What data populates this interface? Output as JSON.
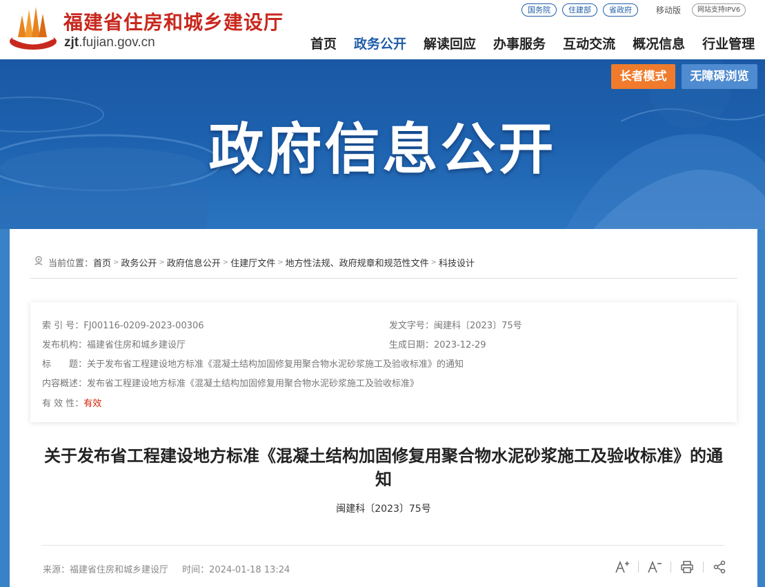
{
  "site": {
    "name": "福建省住房和城乡建设厅",
    "domain_prefix": "zjt",
    "domain_suffix": ".fujian.gov.cn"
  },
  "top_links": [
    "国务院",
    "住建部",
    "省政府"
  ],
  "mobile_label": "移动版",
  "ipv6_label": "网站支持IPV6",
  "nav": [
    "首页",
    "政务公开",
    "解读回应",
    "办事服务",
    "互动交流",
    "概况信息",
    "行业管理"
  ],
  "nav_active": "政务公开",
  "banner": {
    "title": "政府信息公开",
    "elder_mode": "长者模式",
    "accessible": "无障碍浏览"
  },
  "breadcrumb": {
    "label": "当前位置：",
    "items": [
      "首页",
      "政务公开",
      "政府信息公开",
      "住建厅文件",
      "地方性法规、政府规章和规范性文件",
      "科技设计"
    ]
  },
  "meta": {
    "index_label": "索 引 号：",
    "index_value": "FJ00116-0209-2023-00306",
    "doc_no_label": "发文字号：",
    "doc_no_value": "闽建科〔2023〕75号",
    "issuer_label": "发布机构：",
    "issuer_value": "福建省住房和城乡建设厅",
    "date_label": "生成日期：",
    "date_value": "2023-12-29",
    "title_label": "标　　题：",
    "title_value": "关于发布省工程建设地方标准《混凝土结构加固修复用聚合物水泥砂浆施工及验收标准》的通知",
    "summary_label": "内容概述：",
    "summary_value": "发布省工程建设地方标准《混凝土结构加固修复用聚合物水泥砂浆施工及验收标准》",
    "validity_label": "有 效 性：",
    "validity_value": "有效"
  },
  "document": {
    "title": "关于发布省工程建设地方标准《混凝土结构加固修复用聚合物水泥砂浆施工及验收标准》的通知",
    "number": "闽建科〔2023〕75号",
    "source": "来源：福建省住房和城乡建设厅",
    "time": "时间：2024-01-18 13:24"
  },
  "colors": {
    "brand_red": "#c8281e",
    "nav_active": "#1f5ca8",
    "elder_button": "#f07b2c",
    "accessible_button": "#4f8bd0",
    "validity_red": "#d81e06"
  },
  "icons": [
    "logo-emblem",
    "location-icon",
    "font-increase-icon",
    "font-decrease-icon",
    "print-icon",
    "share-icon"
  ]
}
